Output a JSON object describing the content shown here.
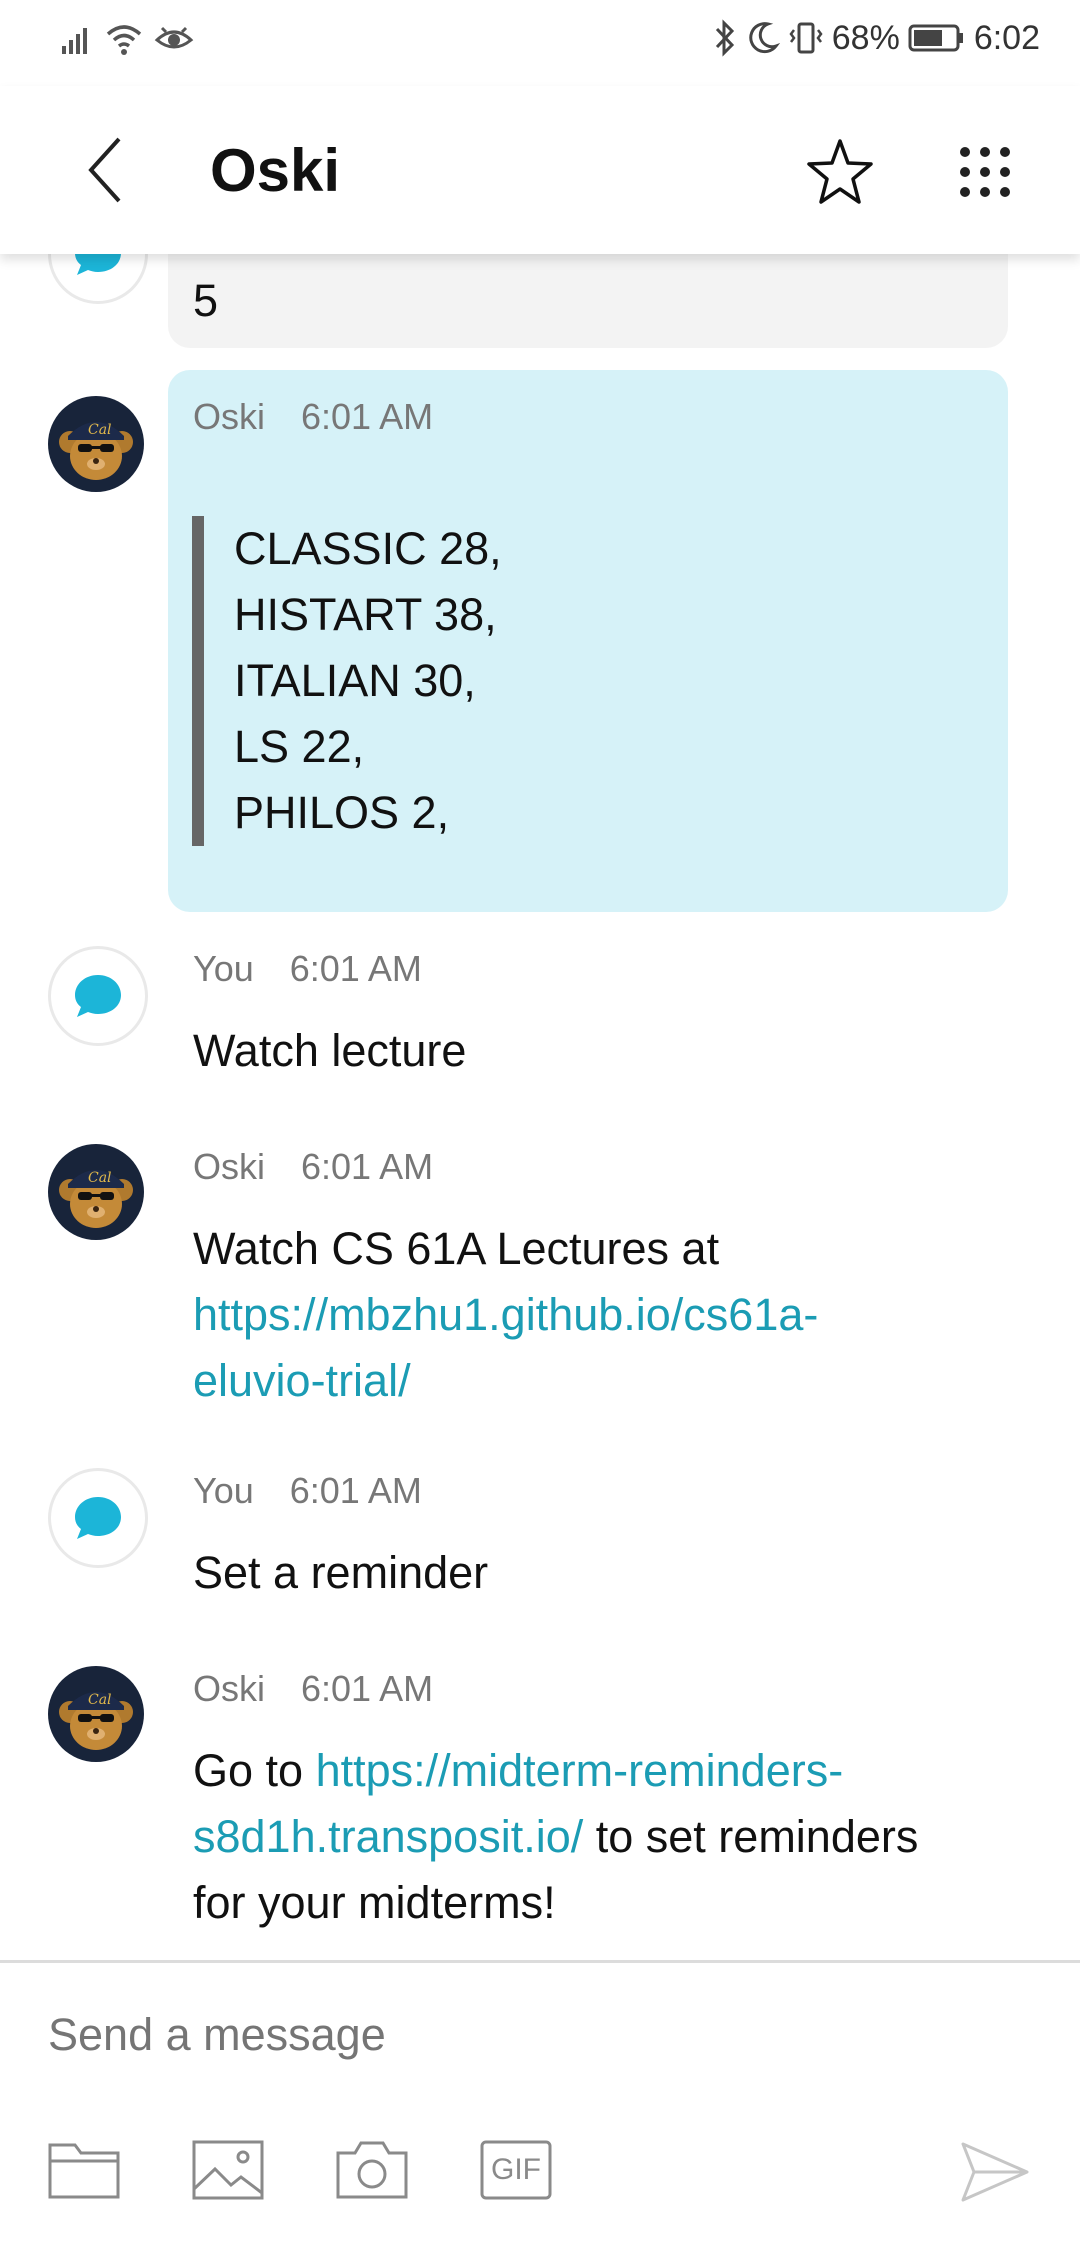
{
  "status_bar": {
    "battery": "68%",
    "time": "6:02"
  },
  "header": {
    "title": "Oski",
    "back_icon": "chevron-left-icon",
    "favorite_icon": "star-outline-icon",
    "menu_icon": "apps-grid-icon"
  },
  "messages": [
    {
      "sender": "",
      "time": "",
      "text": "5"
    },
    {
      "sender": "Oski",
      "time": "6:01 AM",
      "quote_lines": [
        "CLASSIC 28,",
        "HISTART 38,",
        "ITALIAN 30,",
        "LS 22,",
        "PHILOS 2,"
      ]
    },
    {
      "sender": "You",
      "time": "6:01 AM",
      "text": "Watch lecture"
    },
    {
      "sender": "Oski",
      "time": "6:01 AM",
      "text_before": "Watch CS 61A Lectures at",
      "link": "https://mbzhu1.github.io/cs61a-eluvio-trial/",
      "link_line1": "https://mbzhu1.github.io/cs61a-",
      "link_line2": "eluvio-trial/"
    },
    {
      "sender": "You",
      "time": "6:01 AM",
      "text": "Set a reminder"
    },
    {
      "sender": "Oski",
      "time": "6:01 AM",
      "text_before": "Go to ",
      "link_line1": "https://midterm-reminders-",
      "link_line2": "s8d1h.transposit.io/",
      "text_after": " to set reminders",
      "text_last": "for your midterms!"
    }
  ],
  "composer": {
    "placeholder": "Send a message",
    "tools": [
      "folder-icon",
      "image-icon",
      "camera-icon",
      "gif-icon"
    ],
    "gif_label": "GIF",
    "send_icon": "send-icon"
  },
  "colors": {
    "accent": "#1b9cb4",
    "bot_bubble": "#d6f2f8",
    "user_icon": "#1cb5d8"
  }
}
